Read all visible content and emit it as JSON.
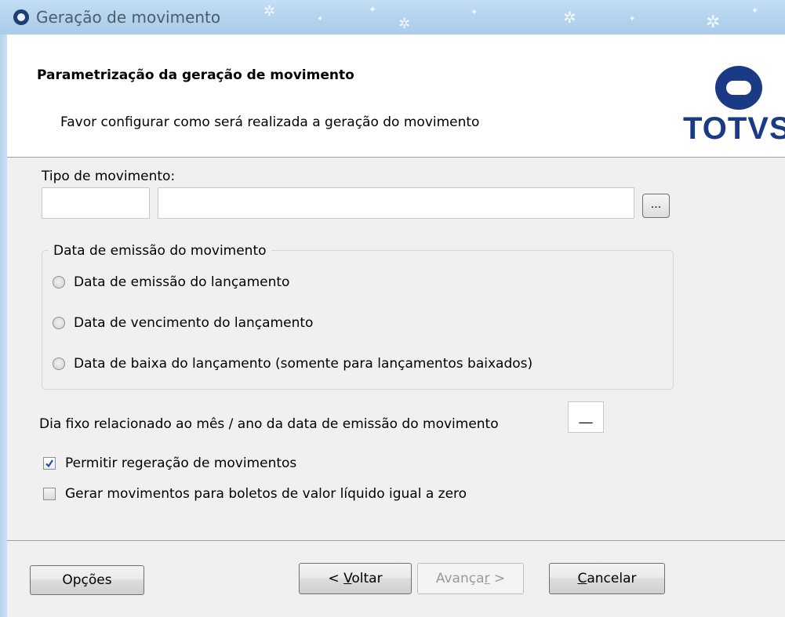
{
  "window": {
    "title": "Geração de movimento"
  },
  "header": {
    "title": "Parametrização da geração de movimento",
    "subtitle": "Favor configurar como será realizada a geração do movimento",
    "logo_text": "TOTVS"
  },
  "form": {
    "tipo_label": "Tipo de movimento:",
    "tipo_code_value": "",
    "tipo_desc_value": "",
    "browse_label": "...",
    "data_group": {
      "title": "Data de emissão do movimento",
      "options": [
        {
          "label": "Data de emissão do lançamento",
          "selected": false
        },
        {
          "label": "Data de vencimento do lançamento",
          "selected": false
        },
        {
          "label": "Data de baixa do lançamento (somente para lançamentos baixados)",
          "selected": false
        }
      ]
    },
    "dia_fixo_label": "Dia fixo relacionado ao mês / ano da data de emissão do movimento",
    "dia_fixo_value": "__",
    "checks": [
      {
        "label": "Permitir regeração de movimentos",
        "checked": true
      },
      {
        "label": "Gerar movimentos para boletos de valor líquido igual a zero",
        "checked": false
      }
    ]
  },
  "footer": {
    "options_label": "Opções",
    "back_prefix": "< ",
    "back_mnemonic": "V",
    "back_rest": "oltar",
    "next_prefix": "Avança",
    "next_mnemonic": "r",
    "next_rest": " >",
    "cancel_mnemonic": "C",
    "cancel_rest": "ancelar"
  },
  "colors": {
    "logo_blue": "#1a3a86",
    "titlebar": "#b6d4ee",
    "check_mark": "#2b4f9e"
  }
}
